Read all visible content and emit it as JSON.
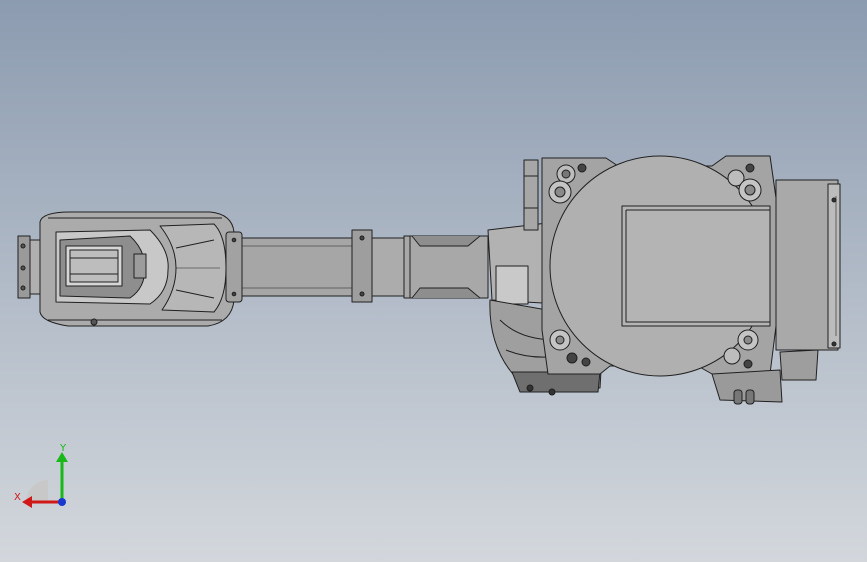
{
  "viewport": {
    "background_top": "#8c9bb0",
    "background_bottom": "#d3d7dc"
  },
  "model": {
    "part_color": "#a9a9a9",
    "edge_color": "#202020",
    "shadow_color": "#5c5c5c"
  },
  "triad": {
    "x_label": "X",
    "y_label": "Y",
    "x_color": "#d01818",
    "y_color": "#18b818",
    "z_color": "#1838d0"
  }
}
